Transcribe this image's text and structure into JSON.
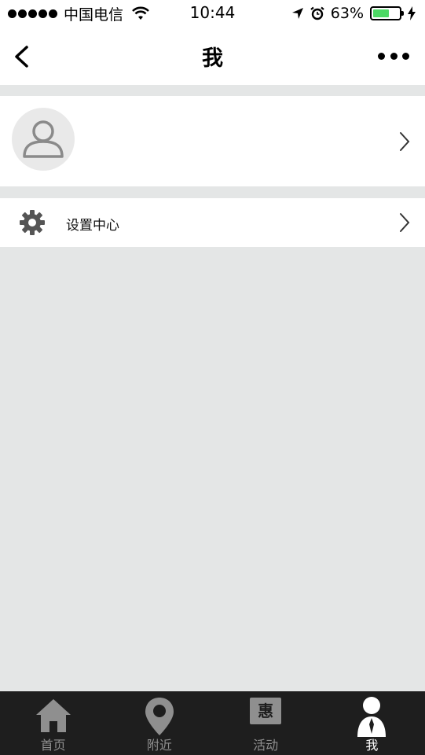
{
  "status_bar": {
    "carrier": "中国电信",
    "time": "10:44",
    "battery_percent": "63%",
    "battery_level": 0.63,
    "icons": [
      "signal-dots-icon",
      "wifi-icon",
      "location-arrow-icon",
      "alarm-icon",
      "battery-icon",
      "charging-icon"
    ]
  },
  "navbar": {
    "title": "我",
    "back_icon": "chevron-left-icon",
    "more_icon": "more-dots-icon"
  },
  "profile": {
    "avatar_icon": "user-avatar-icon",
    "chevron_icon": "chevron-right-icon"
  },
  "menu": {
    "settings": {
      "label": "设置中心",
      "icon": "gear-icon"
    }
  },
  "tabbar": {
    "tabs": [
      {
        "label": "首页",
        "icon": "home-icon",
        "active": false
      },
      {
        "label": "附近",
        "icon": "map-pin-icon",
        "active": false
      },
      {
        "label": "活动",
        "icon": "hui-badge-icon",
        "badge_text": "惠",
        "active": false
      },
      {
        "label": "我",
        "icon": "person-icon",
        "active": true
      }
    ]
  },
  "colors": {
    "background": "#e4e6e6",
    "surface": "#ffffff",
    "tabbar": "#1e1e1e",
    "tab_inactive": "#8f8f8f",
    "tab_active": "#ffffff",
    "battery": "#4cd964"
  }
}
